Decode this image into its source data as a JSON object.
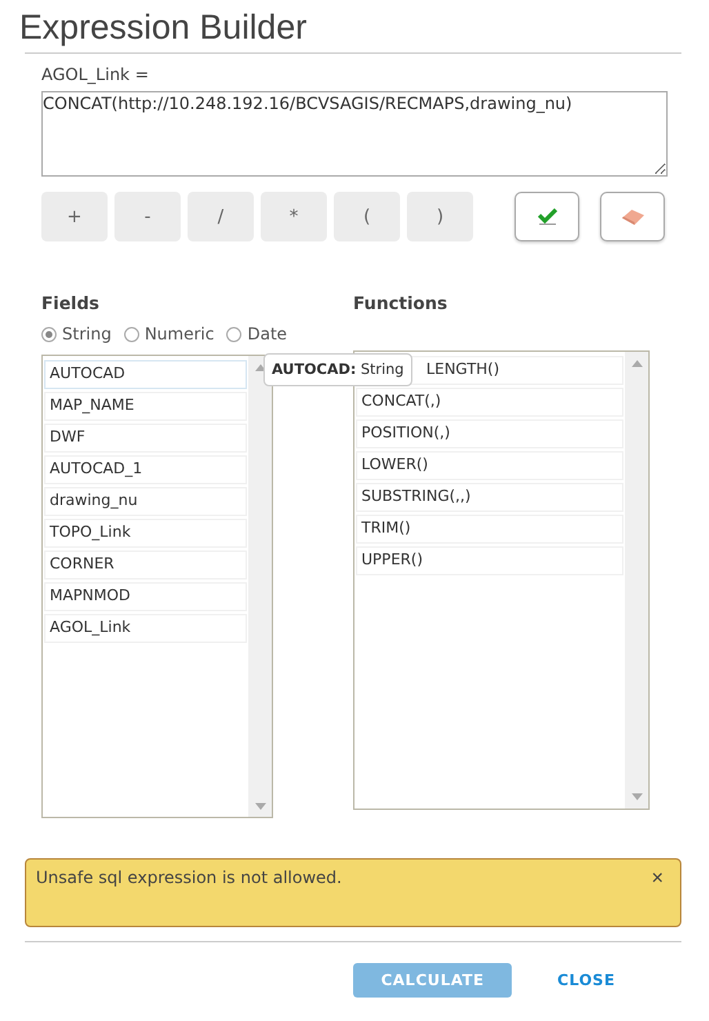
{
  "dialog": {
    "title": "Expression Builder"
  },
  "expression": {
    "label": "AGOL_Link =",
    "value": "CONCAT(http://10.248.192.16/BCVSAGIS/RECMAPS,drawing_nu)"
  },
  "operators": [
    "+",
    "-",
    "/",
    "*",
    "(",
    ")"
  ],
  "fields": {
    "heading": "Fields",
    "types": [
      {
        "label": "String",
        "selected": true
      },
      {
        "label": "Numeric",
        "selected": false
      },
      {
        "label": "Date",
        "selected": false
      }
    ],
    "items": [
      {
        "label": "AUTOCAD",
        "selected": true
      },
      {
        "label": "MAP_NAME",
        "selected": false
      },
      {
        "label": "DWF",
        "selected": false
      },
      {
        "label": "AUTOCAD_1",
        "selected": false
      },
      {
        "label": "drawing_nu",
        "selected": false
      },
      {
        "label": "TOPO_Link",
        "selected": false
      },
      {
        "label": "CORNER",
        "selected": false
      },
      {
        "label": "MAPNMOD",
        "selected": false
      },
      {
        "label": "AGOL_Link",
        "selected": false
      }
    ]
  },
  "tooltip": {
    "name": "AUTOCAD:",
    "type": "String"
  },
  "functions": {
    "heading": "Functions",
    "items": [
      {
        "label": "LENGTH()",
        "covered": true
      },
      {
        "label": "CONCAT(,)",
        "covered": false
      },
      {
        "label": "POSITION(,)",
        "covered": false
      },
      {
        "label": "LOWER()",
        "covered": false
      },
      {
        "label": "SUBSTRING(,,)",
        "covered": false
      },
      {
        "label": "TRIM()",
        "covered": false
      },
      {
        "label": "UPPER()",
        "covered": false
      }
    ]
  },
  "alert": {
    "message": "Unsafe sql expression is not allowed.",
    "close": "×"
  },
  "buttons": [
    {
      "label": "CALCULATE",
      "disabled": true,
      "kind": "primary"
    },
    {
      "label": "CLOSE",
      "disabled": false,
      "kind": "link"
    }
  ]
}
